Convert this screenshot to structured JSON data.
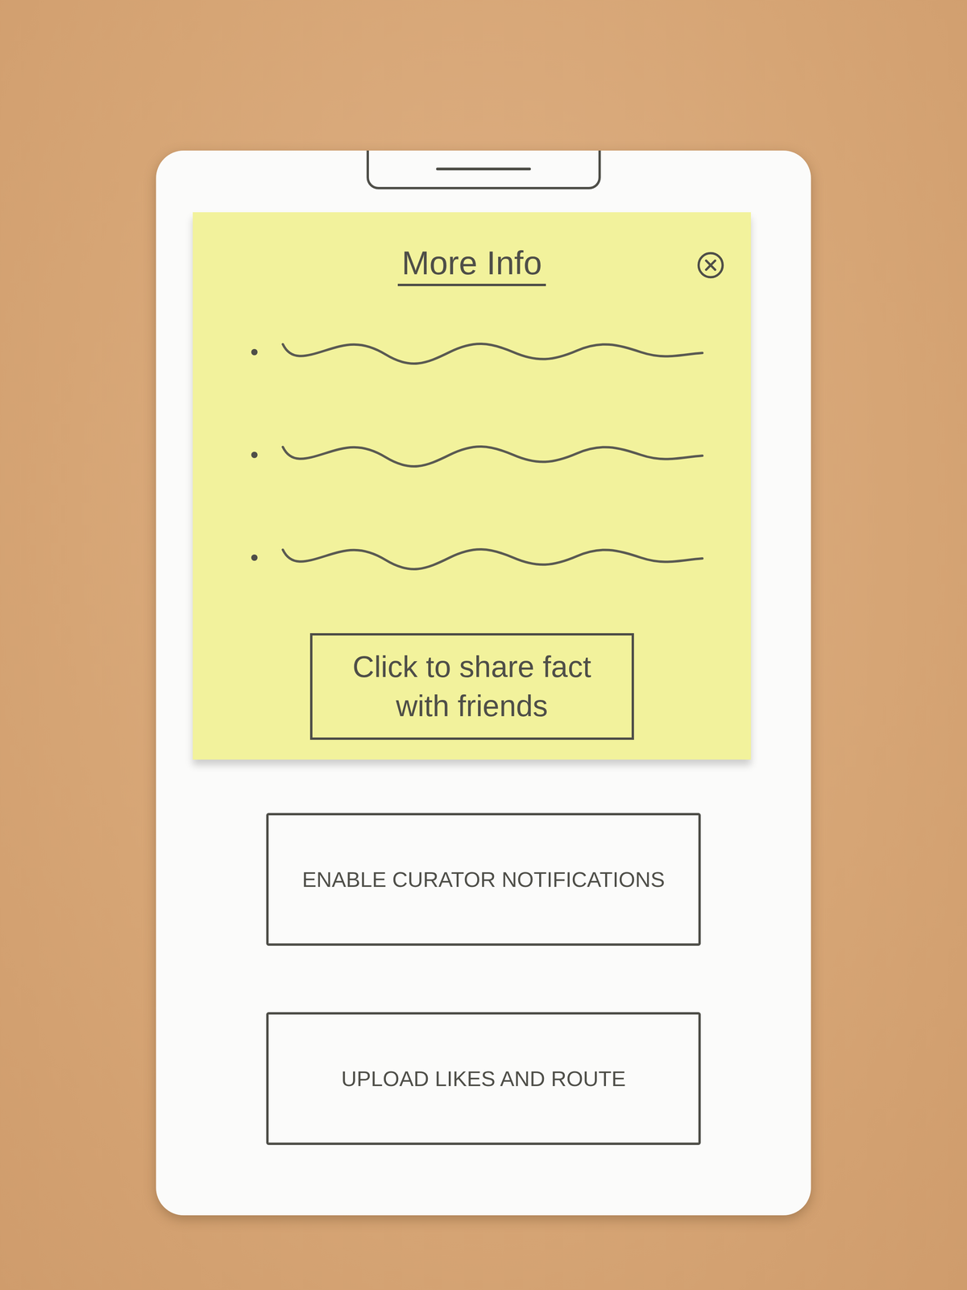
{
  "sheet": {
    "title": "More Info",
    "closable": true,
    "bullets": [
      {
        "kind": "scribble"
      },
      {
        "kind": "scribble"
      },
      {
        "kind": "scribble"
      }
    ],
    "share_button": "Click to share fact with friends"
  },
  "buttons": [
    "ENABLE CURATOR NOTIFICATIONS",
    "UPLOAD LIKES AND ROUTE"
  ]
}
